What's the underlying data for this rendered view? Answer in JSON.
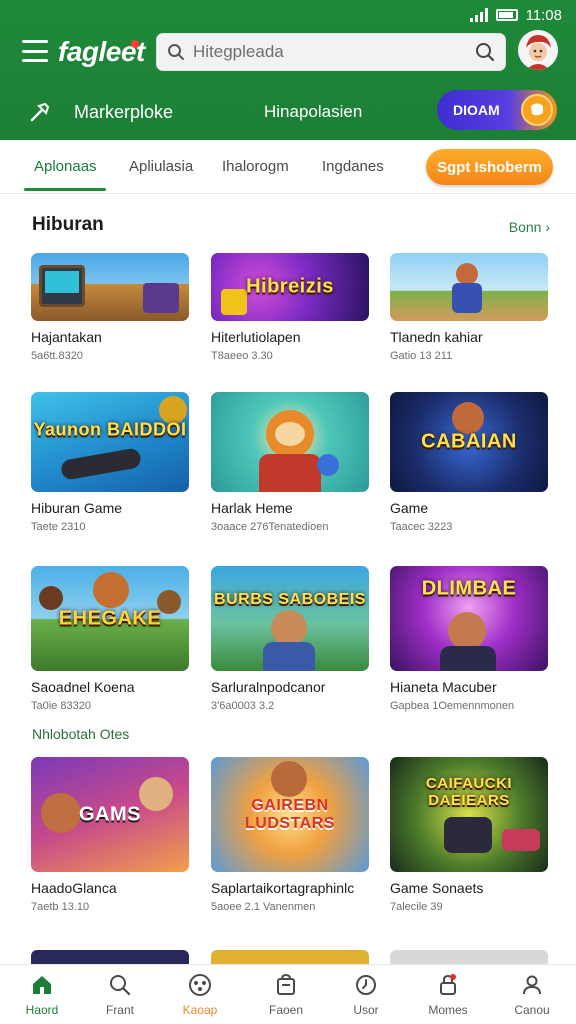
{
  "status_bar": {
    "time": "11:08"
  },
  "header": {
    "logo": "fagleet",
    "search_placeholder": "Hitegpleada",
    "marketplace_label": "Markerploke",
    "middle_label": "Hinapolasien",
    "toggle_label": "DIOAM"
  },
  "tabs": {
    "items": [
      "Aplonaas",
      "Apliulasia",
      "Ihalorogm",
      "Ingdanes"
    ],
    "cta": "Sgpt Ishoberm"
  },
  "section": {
    "title": "Hiburan",
    "see_all": "Bonn"
  },
  "subsection": {
    "title": "Nhlobotah Otes"
  },
  "cards": [
    {
      "title": "Hajantakan",
      "sub": "5a6tt.8320",
      "art": ""
    },
    {
      "title": "Hiterlutiolapen",
      "sub": "T8aeeo 3.30",
      "art": "Hibreizis"
    },
    {
      "title": "Tlanedn kahiar",
      "sub": "Gatio 13 211",
      "art": ""
    },
    {
      "title": "Hiburan Game",
      "sub": "Taete 2310",
      "art": "Yaunon BAIDDOI"
    },
    {
      "title": "Harlak Heme",
      "sub": "3oaace 276Tenatedioen",
      "art": ""
    },
    {
      "title": "Game",
      "sub": "Taacec 3223",
      "art": "CABAIAN"
    },
    {
      "title": "Saoadnel Koena",
      "sub": "Ta0ie 83320",
      "art": "EHEGAKE"
    },
    {
      "title": "Sarluralnpodcanor",
      "sub": "3'6a0003 3.2",
      "art": "BURBS SABOBEIS"
    },
    {
      "title": "Hianeta Macuber",
      "sub": "Gapbea 1Oemennmonen",
      "art": "DLIMBAE"
    },
    {
      "title": "HaadoGlanca",
      "sub": "7aetb 13.10",
      "art": "GAMS"
    },
    {
      "title": "Saplartaikortagraphinlc",
      "sub": "5aoee 2.1 Vanenmen",
      "art": "GAIREBN LUDSTARS"
    },
    {
      "title": "Game Sonaets",
      "sub": "7alecile 39",
      "art": "CAIFAUCKI DAEIEARS"
    }
  ],
  "bottom_nav": [
    "Haord",
    "Frant",
    "Kaoap",
    "Faoen",
    "Usor",
    "Momes",
    "Canou"
  ],
  "colors": {
    "brand_green": "#1f8a3a",
    "accent_orange": "#f4861b",
    "accent_purple": "#3c2fd1"
  }
}
